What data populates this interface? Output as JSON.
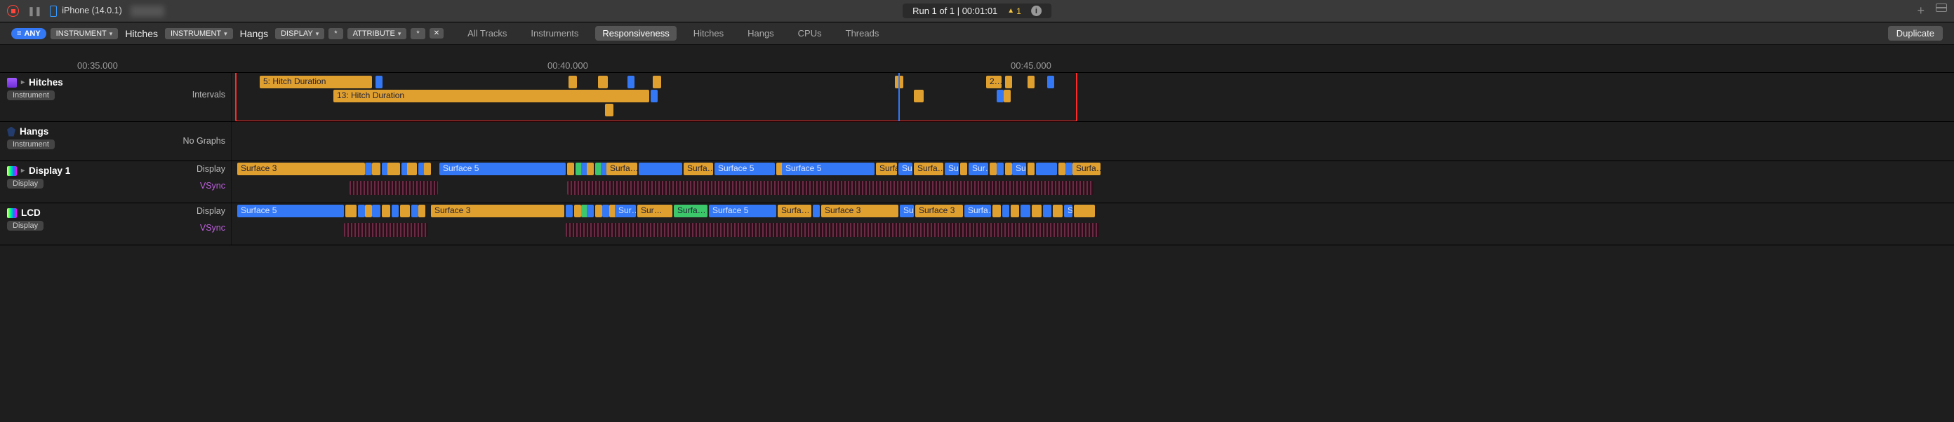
{
  "toolbar": {
    "device": "iPhone (14.0.1)",
    "run_status": "Run 1 of 1  |  00:01:01",
    "warn_count": "1",
    "duplicate": "Duplicate"
  },
  "filter": {
    "any": "ANY",
    "instrument": "INSTRUMENT",
    "hitches": "Hitches",
    "hangs": "Hangs",
    "display": "DISPLAY",
    "attribute": "ATTRIBUTE"
  },
  "tabs": {
    "all": "All Tracks",
    "inst": "Instruments",
    "resp": "Responsiveness",
    "hitch": "Hitches",
    "hang": "Hangs",
    "cpu": "CPUs",
    "thr": "Threads"
  },
  "ruler": {
    "t1": "00:35.000",
    "t2": "00:40.000",
    "t3": "00:45.000"
  },
  "rows": {
    "hitches": "Hitches",
    "hangs": "Hangs",
    "disp1": "Display 1",
    "lcd": "LCD",
    "instrument_badge": "Instrument",
    "display_badge": "Display",
    "intervals": "Intervals",
    "no_graphs": "No Graphs",
    "display_lbl": "Display",
    "vsync_lbl": "VSync"
  },
  "bars": {
    "h5": "5: Hitch Duration",
    "h13": "13: Hitch Duration",
    "h2": "2…",
    "s3": "Surface 3",
    "s5": "Surface 5",
    "surf": "Surfa…",
    "sur": "Sur…",
    "su": "Su…"
  }
}
